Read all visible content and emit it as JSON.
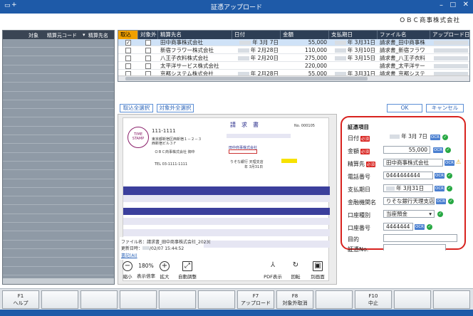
{
  "window": {
    "title": "証憑アップロード",
    "left_label": "+"
  },
  "company": "ＯＢＣ商事株式会社",
  "left_table": {
    "columns": [
      "対象",
      "精算元コード",
      "精算先名"
    ]
  },
  "upload_table": {
    "columns": [
      "取込",
      "対象外",
      "精算先名",
      "日付",
      "金額",
      "支払期日",
      "ファイル名",
      "アップロード日"
    ],
    "rows": [
      {
        "import": true,
        "exclude": false,
        "payee": "田中商事株式会社",
        "date": "年  3月  7日",
        "amount": "55,000",
        "due": "年  3月31日",
        "file": "請求書_田中商事株"
      },
      {
        "import": false,
        "exclude": false,
        "payee": "新宿フラワー株式会社",
        "date": "年  2月28日",
        "amount": "110,000",
        "due": "年  3月10日",
        "file": "請求書_新宿フラワ"
      },
      {
        "import": false,
        "exclude": false,
        "payee": "八王子衣料株式会社",
        "date": "年  2月20日",
        "amount": "275,000",
        "due": "年  3月15日",
        "file": "請求書_八王子衣料"
      },
      {
        "import": false,
        "exclude": false,
        "payee": "太平洋サービス株式会社",
        "date": "",
        "amount": "220,000",
        "due": "",
        "file": "請求書_太平洋サー"
      },
      {
        "import": false,
        "exclude": false,
        "payee": "京都システム株式会社",
        "date": "年  2月28日",
        "amount": "55,000",
        "due": "年  3月31日",
        "file": "請求書_京都システ"
      }
    ]
  },
  "buttons": {
    "select_all": "取込全選択",
    "exclude_all": "対象外全選択",
    "ok": "OK",
    "cancel": "キャンセル"
  },
  "invoice": {
    "title": "請　求　書",
    "timestamp_stamp": "TIME STAMP",
    "postal": "111-1111",
    "address": "東京都新宿区西新宿１－２－３",
    "bldg": "西新宿ビル３Ｆ",
    "recipient": "ＯＢＣ商事株式会社 御中",
    "tel": "TEL 03-1111-1111",
    "no_label": "No. 000105",
    "issuer": "田中商事株式会社",
    "bank": "りそな銀行 天理支店",
    "due": "年 3月31日"
  },
  "file_info": {
    "name_label": "ファイル名：",
    "name_value": "請求書_田中商事株式会社_2023(",
    "updated_label": "更新日時：",
    "updated_value": "/02/07 15:44:52",
    "ai_link": "書記(AI)"
  },
  "viewer_tools": {
    "zoom_out": "縮小",
    "zoom_value": "180%",
    "zoom_label": "表示倍率",
    "zoom_in": "拡大",
    "auto_fit": "自動調整",
    "pdf": "PDF表示",
    "rotate": "回転",
    "separate": "別画面"
  },
  "voucher": {
    "heading": "証憑項目",
    "required_badge": "必須",
    "ocr_badge": "OCR",
    "fields": {
      "date_label": "日付",
      "date_value": "年  3月  7日",
      "amount_label": "金額",
      "amount_value": "55,000",
      "payee_label": "精算先",
      "payee_value": "田中商事株式会社",
      "phone_label": "電話番号",
      "phone_value": "0444444444",
      "due_label": "支払期日",
      "due_value": "年  3月31日",
      "bank_label": "金融機関名",
      "bank_value": "りそな銀行天理支店",
      "acct_type_label": "口座種別",
      "acct_type_value": "当座預金",
      "acct_no_label": "口座番号",
      "acct_no_value": "4444444",
      "purpose_label": "目的",
      "purpose_value": "",
      "voucher_no_label": "証憑No.",
      "voucher_no_value": ""
    }
  },
  "function_keys": [
    {
      "key": "F1",
      "label": "ヘルプ"
    },
    {
      "key": "",
      "label": ""
    },
    {
      "key": "",
      "label": ""
    },
    {
      "key": "",
      "label": ""
    },
    {
      "key": "",
      "label": ""
    },
    {
      "key": "",
      "label": ""
    },
    {
      "key": "F7",
      "label": "アップロード"
    },
    {
      "key": "F8",
      "label": "対象外取消"
    },
    {
      "key": "",
      "label": ""
    },
    {
      "key": "F10",
      "label": "中止"
    },
    {
      "key": "",
      "label": ""
    },
    {
      "key": "",
      "label": ""
    }
  ],
  "colors": {
    "titlebar": "#1e5aa8",
    "header": "#2d3e55",
    "highlight": "#f0a000",
    "required": "#d8221e",
    "ok": "#27a843",
    "panel_border": "#d8221e"
  }
}
